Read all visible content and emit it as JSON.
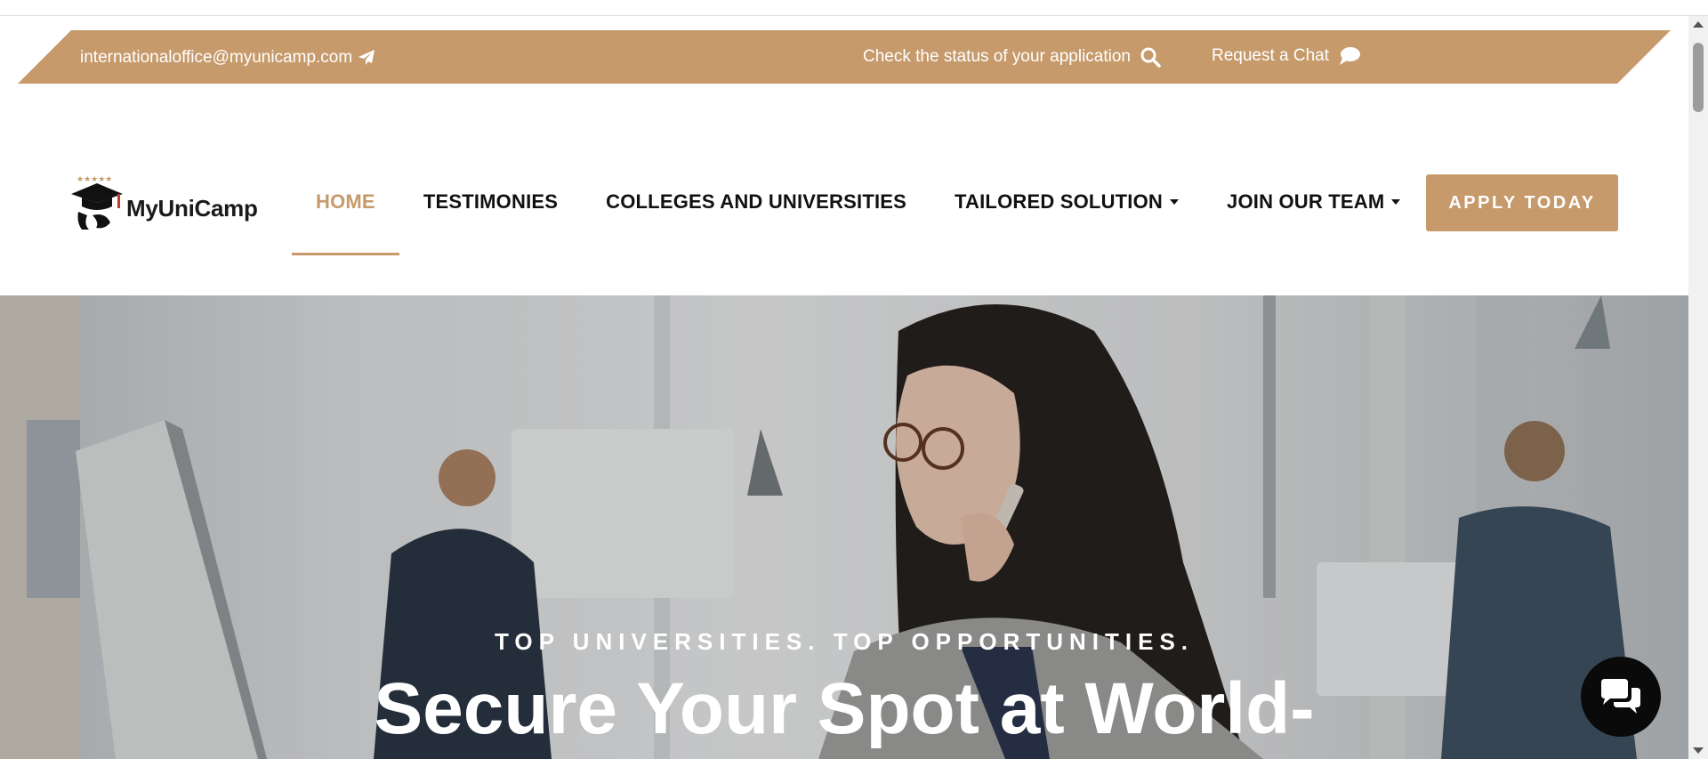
{
  "topbar": {
    "email": "internationaloffice@myunicamp.com",
    "status_text": "Check the status of your application",
    "chat_text": "Request a Chat",
    "icons": {
      "email": "paper-plane-icon",
      "status": "search-icon",
      "chat": "comment-icon"
    }
  },
  "brand": {
    "name": "MyUniCamp",
    "logo_icon": "graduation-cap-logo"
  },
  "nav": {
    "items": [
      {
        "label": "HOME",
        "active": true
      },
      {
        "label": "TESTIMONIES"
      },
      {
        "label": "COLLEGES AND UNIVERSITIES"
      },
      {
        "label": "TAILORED SOLUTION",
        "dropdown": true
      },
      {
        "label": "JOIN OUR TEAM",
        "dropdown": true
      }
    ],
    "cta": "APPLY TODAY"
  },
  "hero": {
    "tagline": "TOP UNIVERSITIES. TOP OPPORTUNITIES.",
    "title": "Secure Your Spot at World-"
  },
  "colors": {
    "accent": "#c69a6b",
    "text": "#111111",
    "fab": "#0a0a0a"
  }
}
